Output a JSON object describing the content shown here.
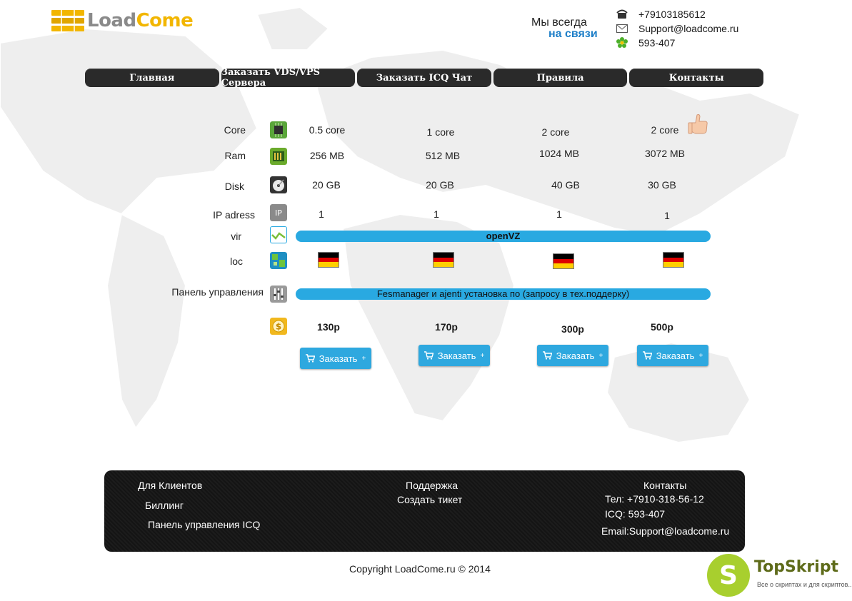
{
  "header": {
    "logo_part1": "Load",
    "logo_part2": "Come",
    "tagline_line1": "Мы всегда",
    "tagline_line2": "на связи",
    "phone": "+79103185612",
    "email": "Support@loadcome.ru",
    "icq": "593-407"
  },
  "nav": {
    "items": [
      "Главная",
      "Заказать VDS/VPS Сервера",
      "Заказать ICQ  Чат",
      "Правила",
      "Контакты"
    ]
  },
  "specs": {
    "labels": {
      "core": "Core",
      "ram": "Ram",
      "disk": "Disk",
      "ip": "IP adress",
      "vir": "vir",
      "loc": "loc",
      "panel": "Панель управления"
    },
    "plans": [
      {
        "core": "0.5 core",
        "ram": "256 MB",
        "disk": "20 GB",
        "ip": "1",
        "price": "130р"
      },
      {
        "core": "1 core",
        "ram": "512 MB",
        "disk": "20 GB",
        "ip": "1",
        "price": "170р"
      },
      {
        "core": "2 core",
        "ram": "1024 MB",
        "disk": "40 GB",
        "ip": "1",
        "price": "300р"
      },
      {
        "core": "2 core",
        "ram": "3072 MB",
        "disk": "30 GB",
        "ip": "1",
        "price": "500р"
      }
    ],
    "virtualization": "openVZ",
    "panel_text": "Fesmanager и ajenti установка   по (запросу в тех.поддерку)",
    "order_label": "Заказать",
    "order_plus": "+"
  },
  "footer": {
    "clients_title": "Для Клиентов",
    "billing": "Биллинг",
    "icq_panel": "Панель  управления ICQ",
    "support_title": "Поддержка",
    "create_ticket": "Создать тикет",
    "contacts_title": "Контакты",
    "tel": "Тел: +7910-318-56-12",
    "icq": "ICQ: 593-407",
    "email": "Email:Support@loadcome.ru"
  },
  "copyright": "Copyright LoadCome.ru © 2014",
  "watermark": {
    "letter": "S",
    "name": "TopSkript",
    "subtitle": "Все о скриптах и для скриптов..."
  },
  "colors": {
    "accent": "#29a9e1",
    "nav_bg": "#2a2a2a",
    "logo_yellow": "#f2b600",
    "tagline_blue": "#1e7fc8"
  }
}
